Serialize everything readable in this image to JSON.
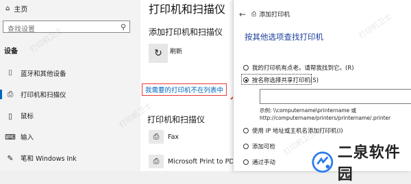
{
  "settings": {
    "home_label": "主页",
    "search_placeholder": "查找设置",
    "section_label": "设备",
    "nav": [
      {
        "label": "蓝牙和其他设备",
        "icon": "bluetooth-icon"
      },
      {
        "label": "打印机和扫描仪",
        "icon": "printer-icon"
      },
      {
        "label": "鼠标",
        "icon": "mouse-icon"
      },
      {
        "label": "输入",
        "icon": "keyboard-icon"
      },
      {
        "label": "笔和 Windows Ink",
        "icon": "pen-icon"
      }
    ]
  },
  "printers_pane": {
    "title": "打印机和扫描仪",
    "add_label": "添加打印机和扫描仪",
    "refresh_label": "刷新",
    "missing_link": "我需要的打印机不在列表中",
    "section_title": "打印机和扫描仪",
    "items": [
      {
        "name": "Fax"
      },
      {
        "name": "Microsoft Print to PDF"
      }
    ]
  },
  "dialog": {
    "window_title": "添加打印机",
    "heading": "按其他选项查找打印机",
    "options": [
      {
        "label": "我的打印机有点老。请帮我找到它。(R)",
        "selected": false
      },
      {
        "label": "按名称选择共享打印机(S)",
        "selected": true
      },
      {
        "label": "使用 IP 地址或主机名添加打印机(I)",
        "selected": false
      },
      {
        "label": "添加可检",
        "selected": false
      },
      {
        "label": "通过手动",
        "selected": false
      }
    ],
    "example_line1": "示例: \\\\computername\\printername 或",
    "example_line2": "http://computername/printers/printername/.printer"
  },
  "logo": {
    "text": "二泉软件园"
  },
  "watermark_text": "打印机卫士"
}
